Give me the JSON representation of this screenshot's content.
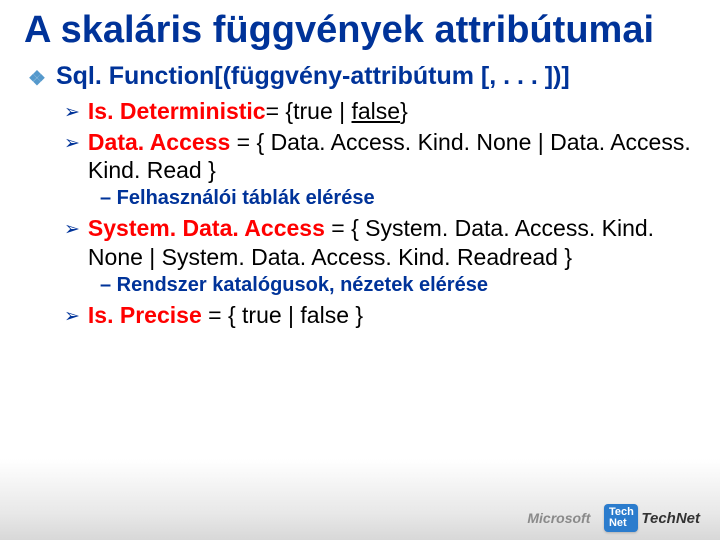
{
  "title": "A skaláris függvények attribútumai",
  "main_bullet": "Sql. Function[(függvény-attribútum [, . . . ])]",
  "items": [
    {
      "kw": "Is. Deterministic",
      "rest_pre": "= {true | ",
      "rest_ul": "false",
      "rest_post": "}",
      "note": null
    },
    {
      "kw": "Data. Access",
      "plain": " = { Data. Access. Kind. None | Data. Access. Kind. Read }",
      "note": "– Felhasználói táblák elérése"
    },
    {
      "kw": "System. Data. Access",
      "plain": " = { System. Data. Access. Kind. None | System. Data. Access. Kind. Readread }",
      "note": "– Rendszer katalógusok, nézetek elérése"
    },
    {
      "kw": "Is. Precise",
      "plain": " = { true | false }",
      "note": null
    }
  ],
  "footer": {
    "ms": "Microsoft",
    "tn_badge": "Tech\nNet",
    "tn_text": "TechNet"
  }
}
